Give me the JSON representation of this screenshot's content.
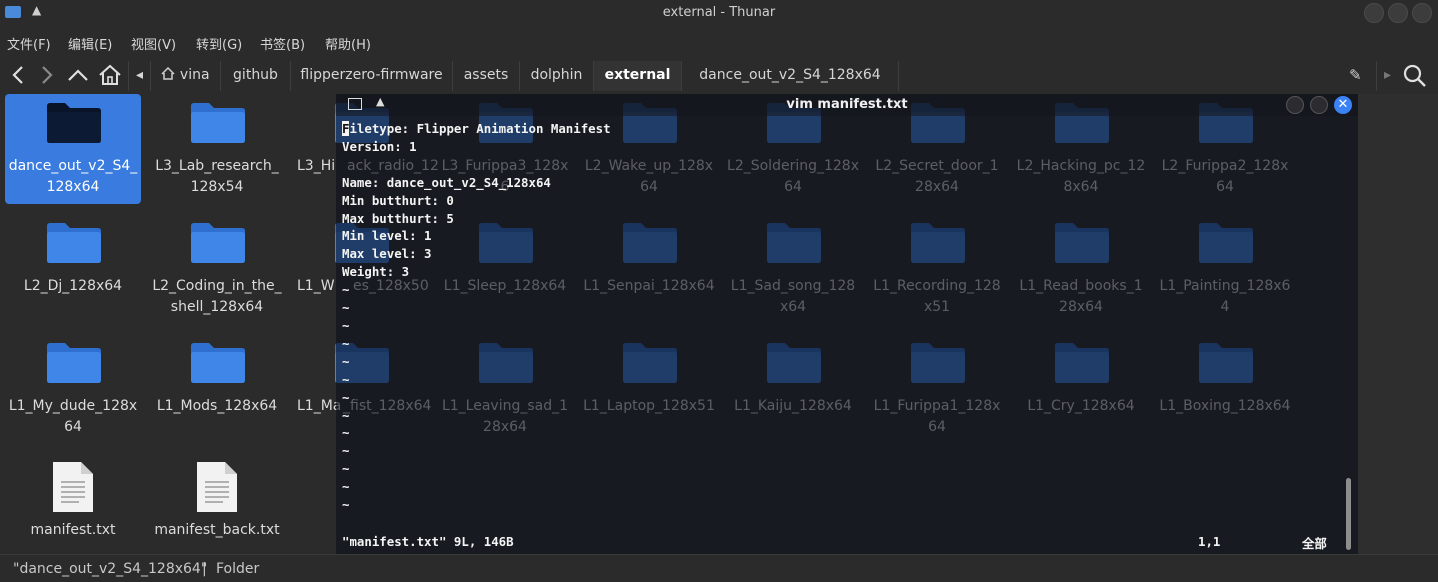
{
  "window": {
    "title": "external - Thunar"
  },
  "menu": [
    "文件(F)",
    "编辑(E)",
    "视图(V)",
    "转到(G)",
    "书签(B)",
    "帮助(H)"
  ],
  "breadcrumbs": [
    {
      "label": "vina"
    },
    {
      "label": "github"
    },
    {
      "label": "flipperzero-firmware"
    },
    {
      "label": "assets"
    },
    {
      "label": "dolphin"
    },
    {
      "label": "external"
    },
    {
      "label": "dance_out_v2_S4_128x64"
    }
  ],
  "items": [
    {
      "label": "dance_out_v2_S4_128x64",
      "type": "folder",
      "selected": true
    },
    {
      "label": "L3_Lab_research_128x54",
      "type": "folder"
    },
    {
      "label": "L3_Hi",
      "type": "folder"
    },
    {
      "label": "ack_radio_12",
      "type": "folder"
    },
    {
      "label": "L3_Furippa3_128x6",
      "type": "folder"
    },
    {
      "label": "L2_Wake_up_128x64",
      "type": "folder"
    },
    {
      "label": "L2_Soldering_128x64",
      "type": "folder"
    },
    {
      "label": "L2_Secret_door_128x64",
      "type": "folder"
    },
    {
      "label": "L2_Hacking_pc_128x64",
      "type": "folder"
    },
    {
      "label": "L2_Furippa2_128x64",
      "type": "folder"
    },
    {
      "label": "L2_Dj_128x64",
      "type": "folder"
    },
    {
      "label": "L2_Coding_in_the_shell_128x64",
      "type": "folder"
    },
    {
      "label": "L1_W",
      "type": "folder"
    },
    {
      "label": "es_128x50",
      "type": "folder"
    },
    {
      "label": "L1_Sleep_128x64",
      "type": "folder"
    },
    {
      "label": "L1_Senpai_128x64",
      "type": "folder"
    },
    {
      "label": "L1_Sad_song_128x64",
      "type": "folder"
    },
    {
      "label": "L1_Recording_128x51",
      "type": "folder"
    },
    {
      "label": "L1_Read_books_128x64",
      "type": "folder"
    },
    {
      "label": "L1_Painting_128x64",
      "type": "folder"
    },
    {
      "label": "L1_My_dude_128x64",
      "type": "folder"
    },
    {
      "label": "L1_Mods_128x64",
      "type": "folder"
    },
    {
      "label": "L1_Ma",
      "type": "folder"
    },
    {
      "label": "_fist_128x64",
      "type": "folder"
    },
    {
      "label": "L1_Leaving_sad_128x64",
      "type": "folder"
    },
    {
      "label": "L1_Laptop_128x51",
      "type": "folder"
    },
    {
      "label": "L1_Kaiju_128x64",
      "type": "folder"
    },
    {
      "label": "L1_Furippa1_128x64",
      "type": "folder"
    },
    {
      "label": "L1_Cry_128x64",
      "type": "folder"
    },
    {
      "label": "L1_Boxing_128x64",
      "type": "folder"
    },
    {
      "label": "manifest.txt",
      "type": "file"
    },
    {
      "label": "manifest_back.txt",
      "type": "file"
    }
  ],
  "status": {
    "selection": "\"dance_out_v2_S4_128x64\"",
    "separator": "|",
    "kind": "Folder"
  },
  "terminal": {
    "title": "vim manifest.txt",
    "cursor_char": "F",
    "first_line_rest": "iletype: Flipper Animation Manifest",
    "lines": [
      "Version: 1",
      "",
      "Name: dance_out_v2_S4_128x64",
      "Min butthurt: 0",
      "Max butthurt: 5",
      "Min level: 1",
      "Max level: 3",
      "Weight: 3"
    ],
    "tilde": "~",
    "status_line": "\"manifest.txt\" 9L, 146B",
    "position": "1,1",
    "scroll_all": "全部"
  },
  "colors": {
    "accent": "#3a7be0",
    "folder": "#3f86e8",
    "close": "#3b82f6"
  }
}
